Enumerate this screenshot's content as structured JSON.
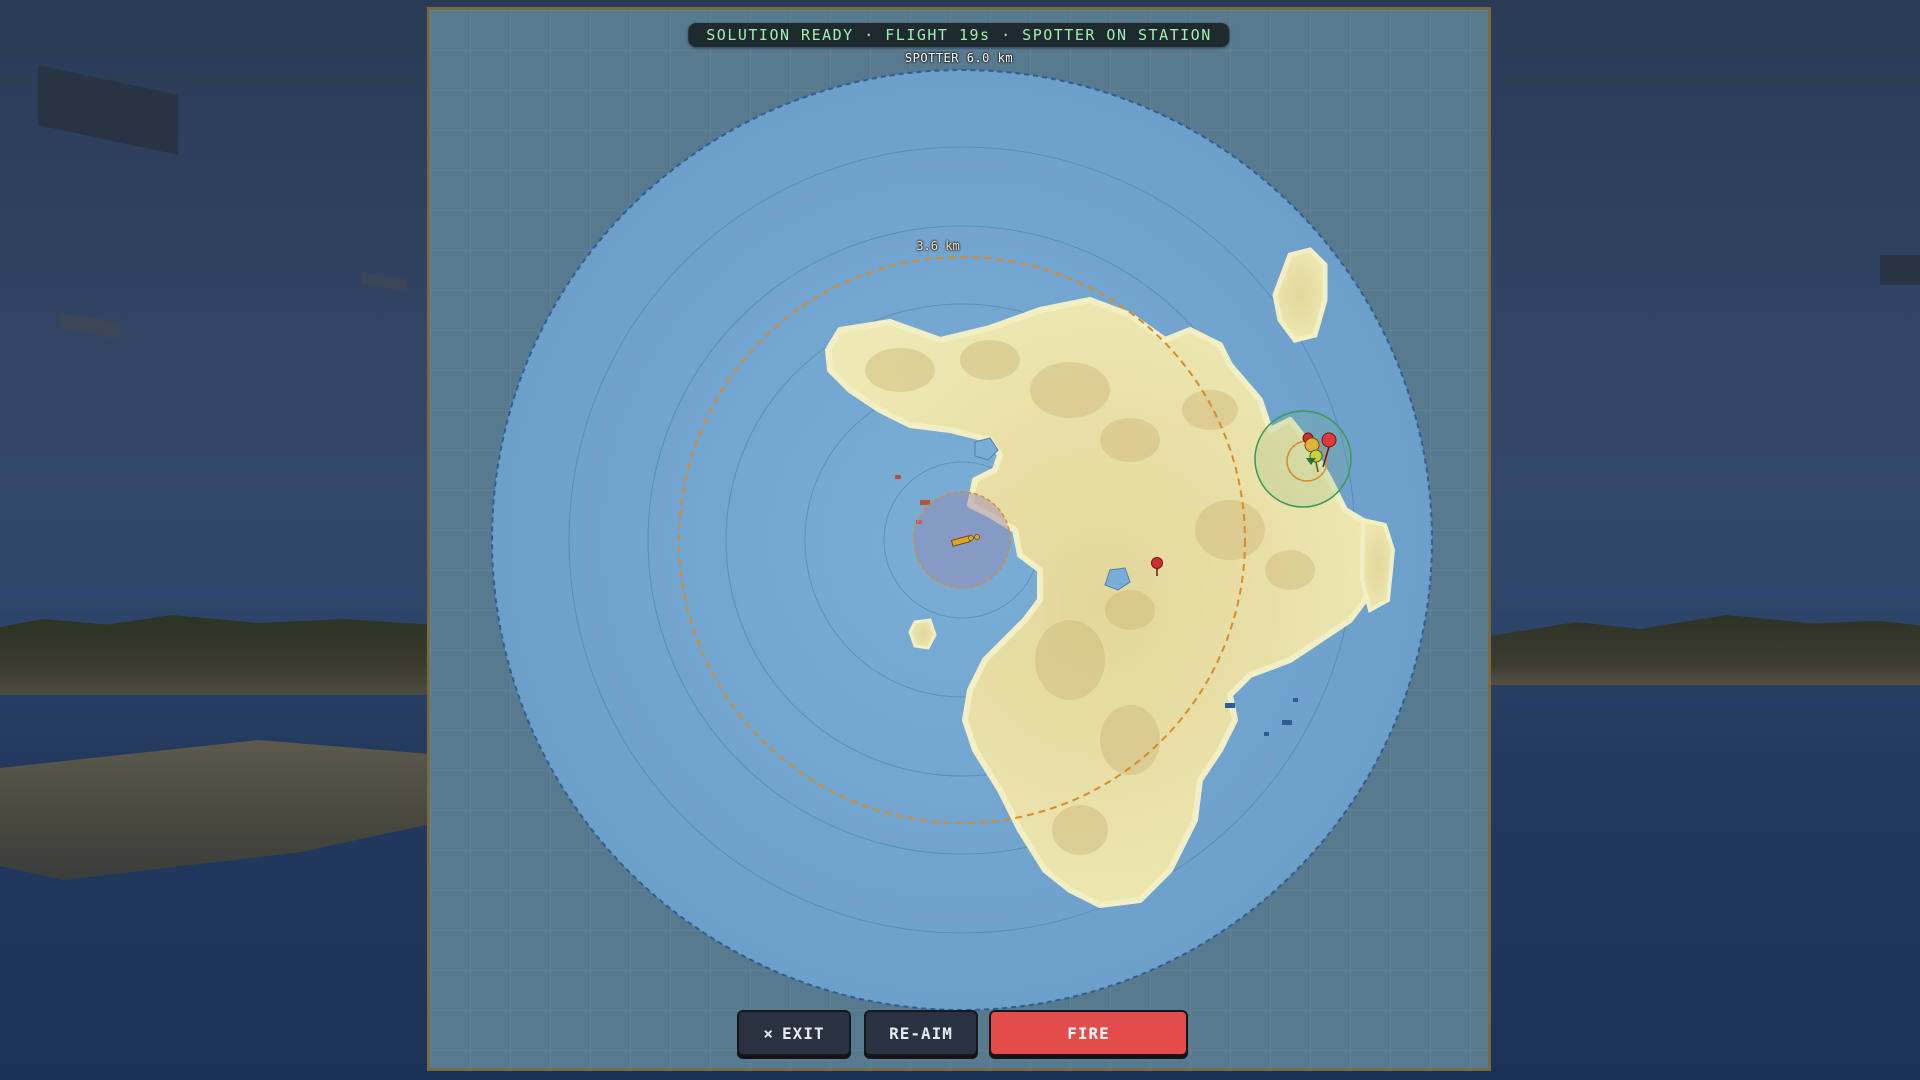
{
  "status": {
    "text": "SOLUTION READY · FLIGHT 19s · SPOTTER ON STATION"
  },
  "map": {
    "spotter_label": "SPOTTER 6.0 km",
    "range_label": "3.6 km",
    "colors": {
      "sea": "#6fa3cf",
      "land": "#e6dfa6",
      "range_ring": "#d98a2a",
      "spotter_ring": "#2e5d96",
      "target_ring": "#3a9a5a",
      "marker": "#d12f2f"
    }
  },
  "buttons": {
    "exit_icon": "close-icon",
    "exit_glyph": "×",
    "exit_label": "EXIT",
    "reaim_label": "RE-AIM",
    "fire_label": "FIRE"
  }
}
